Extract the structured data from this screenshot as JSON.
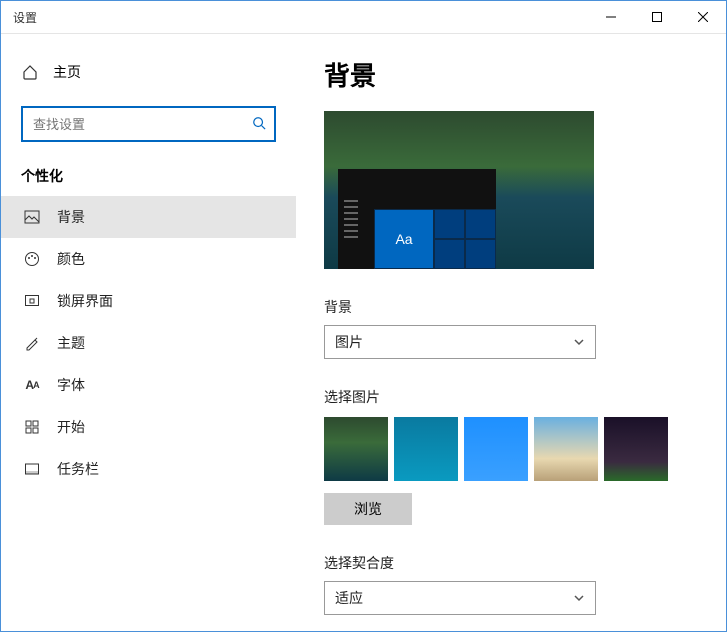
{
  "window": {
    "title": "设置"
  },
  "sidebar": {
    "home_label": "主页",
    "search_placeholder": "查找设置",
    "section_title": "个性化",
    "items": [
      {
        "label": "背景"
      },
      {
        "label": "颜色"
      },
      {
        "label": "锁屏界面"
      },
      {
        "label": "主题"
      },
      {
        "label": "字体"
      },
      {
        "label": "开始"
      },
      {
        "label": "任务栏"
      }
    ]
  },
  "main": {
    "heading": "背景",
    "preview_sample_text": "Aa",
    "background_label": "背景",
    "background_value": "图片",
    "choose_picture_label": "选择图片",
    "browse_label": "浏览",
    "fit_label": "选择契合度",
    "fit_value": "适应"
  }
}
